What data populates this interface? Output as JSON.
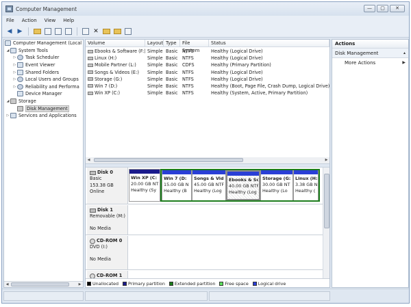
{
  "window": {
    "title": "Computer Management",
    "buttons": {
      "minimize": "—",
      "maximize": "▢",
      "close": "✕"
    }
  },
  "menu": [
    "File",
    "Action",
    "View",
    "Help"
  ],
  "toolbar": {
    "icons": [
      "back-arrow-icon",
      "forward-arrow-icon",
      "up-folder-icon",
      "show-tree-icon",
      "properties-icon",
      "help-icon",
      "export-icon",
      "delete-icon",
      "open-folder-icon",
      "new-folder-icon",
      "search-icon"
    ]
  },
  "tree": {
    "root": "Computer Management (Local",
    "system_tools": "System Tools",
    "task_scheduler": "Task Scheduler",
    "event_viewer": "Event Viewer",
    "shared_folders": "Shared Folders",
    "local_users": "Local Users and Groups",
    "reliability": "Reliability and Performa",
    "device_manager": "Device Manager",
    "storage": "Storage",
    "disk_management": "Disk Management",
    "services": "Services and Applications"
  },
  "volumes": {
    "columns": {
      "volume": "Volume",
      "layout": "Layout",
      "type": "Type",
      "fs": "File System",
      "status": "Status"
    },
    "rows": [
      {
        "volume": "Ebooks & Software (F:)",
        "layout": "Simple",
        "type": "Basic",
        "fs": "NTFS",
        "status": "Healthy (Logical Drive)"
      },
      {
        "volume": "Linux (H:)",
        "layout": "Simple",
        "type": "Basic",
        "fs": "NTFS",
        "status": "Healthy (Logical Drive)"
      },
      {
        "volume": "Mobile Partner (L:)",
        "layout": "Simple",
        "type": "Basic",
        "fs": "CDFS",
        "status": "Healthy (Primary Partition)"
      },
      {
        "volume": "Songs & Videos (E:)",
        "layout": "Simple",
        "type": "Basic",
        "fs": "NTFS",
        "status": "Healthy (Logical Drive)"
      },
      {
        "volume": "Storage (G:)",
        "layout": "Simple",
        "type": "Basic",
        "fs": "NTFS",
        "status": "Healthy (Logical Drive)"
      },
      {
        "volume": "Win 7 (D:)",
        "layout": "Simple",
        "type": "Basic",
        "fs": "NTFS",
        "status": "Healthy (Boot, Page File, Crash Dump, Logical Drive)"
      },
      {
        "volume": "Win XP (C:)",
        "layout": "Simple",
        "type": "Basic",
        "fs": "NTFS",
        "status": "Healthy (System, Active, Primary Partition)"
      }
    ]
  },
  "disks": {
    "disk0": {
      "name": "Disk 0",
      "type": "Basic",
      "size": "153.38 GB",
      "status": "Online",
      "partitions": [
        {
          "name": "Win XP  (C:",
          "size": "20.00 GB NT",
          "status": "Healthy (Sy"
        },
        {
          "name": "Win 7  (D:",
          "size": "15.00 GB N",
          "status": "Healthy (B"
        },
        {
          "name": "Songs & Vid",
          "size": "45.00 GB NTF",
          "status": "Healthy (Log"
        },
        {
          "name": "Ebooks & So",
          "size": "40.00 GB NTF",
          "status": "Healthy (Log"
        },
        {
          "name": "Storage  (G:",
          "size": "30.00 GB NT",
          "status": "Healthy (Lo"
        },
        {
          "name": "Linux  (H:",
          "size": "3.38 GB N",
          "status": "Healthy ("
        }
      ]
    },
    "disk1": {
      "name": "Disk 1",
      "type": "Removable (M:)",
      "media": "No Media"
    },
    "cdrom0": {
      "name": "CD-ROM 0",
      "type": "DVD (I:)",
      "media": "No Media"
    },
    "cdrom1": {
      "name": "CD-ROM 1"
    }
  },
  "legend": [
    {
      "label": "Unallocated",
      "color": "#000000"
    },
    {
      "label": "Primary partition",
      "color": "#1a1a8c"
    },
    {
      "label": "Extended partition",
      "color": "#1c7d1c"
    },
    {
      "label": "Free space",
      "color": "#5fe05f"
    },
    {
      "label": "Logical drive",
      "color": "#2a3fd6"
    }
  ],
  "actions": {
    "header": "Actions",
    "section": "Disk Management",
    "more": "More Actions"
  }
}
